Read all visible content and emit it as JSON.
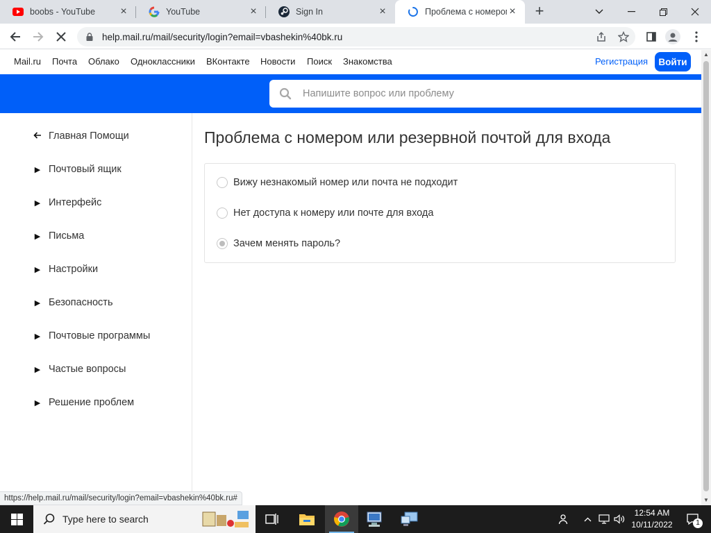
{
  "browser": {
    "tabs": [
      {
        "title": "boobs - YouTube",
        "icon": "youtube-icon"
      },
      {
        "title": "YouTube",
        "icon": "google-icon"
      },
      {
        "title": "Sign In",
        "icon": "steam-icon"
      },
      {
        "title": "Проблема с номером",
        "icon": "loading-spinner-icon",
        "active": true
      }
    ],
    "url": "help.mail.ru/mail/security/login?email=vbashekin%40bk.ru",
    "status_url": "https://help.mail.ru/mail/security/login?email=vbashekin%40bk.ru#"
  },
  "portal_nav": {
    "links": [
      "Mail.ru",
      "Почта",
      "Облако",
      "Одноклассники",
      "ВКонтакте",
      "Новости",
      "Поиск",
      "Знакомства"
    ],
    "register": "Регистрация",
    "login": "Войти"
  },
  "search": {
    "placeholder": "Напишите вопрос или проблему"
  },
  "sidebar": {
    "back": "Главная Помощи",
    "items": [
      "Почтовый ящик",
      "Интерфейс",
      "Письма",
      "Настройки",
      "Безопасность",
      "Почтовые программы",
      "Частые вопросы",
      "Решение проблем"
    ]
  },
  "main": {
    "title": "Проблема с номером или резервной почтой для входа",
    "options": [
      {
        "label": "Вижу незнакомый номер или почта не подходит",
        "checked": false
      },
      {
        "label": "Нет доступа к номеру или почте для входа",
        "checked": false
      },
      {
        "label": "Зачем менять пароль?",
        "checked": true
      }
    ]
  },
  "taskbar": {
    "search_placeholder": "Type here to search",
    "time": "12:54 AM",
    "date": "10/11/2022",
    "notification_count": "1"
  },
  "colors": {
    "brand_blue": "#005ff9",
    "taskbar": "#1c1c1c"
  }
}
